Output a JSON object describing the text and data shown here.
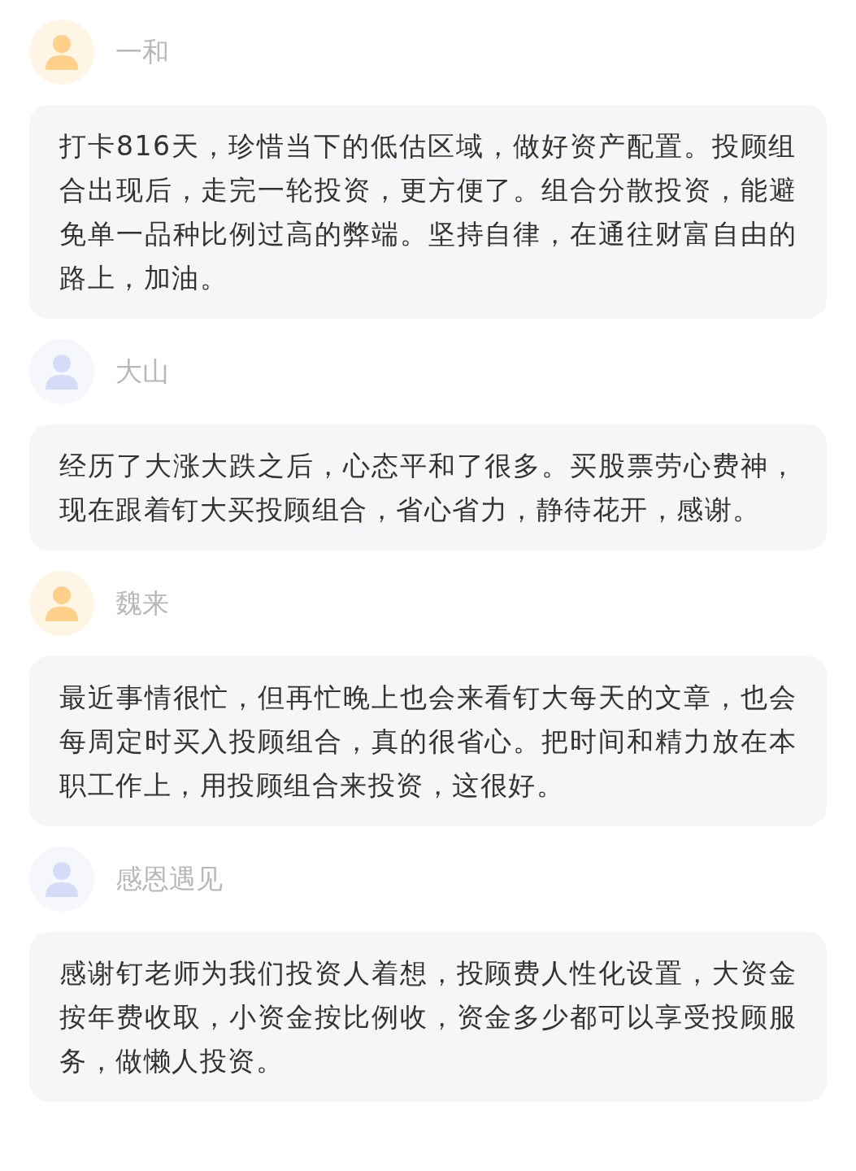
{
  "comments": [
    {
      "name": "一和",
      "color": "#ffd08a",
      "text": "打卡816天，珍惜当下的低估区域，做好资产配置。投顾组合出现后，走完一轮投资，更方便了。组合分散投资，能避免单一品种比例过高的弊端。坚持自律，在通往财富自由的路上，加油。"
    },
    {
      "name": "大山",
      "color": "#d6dcf7",
      "text": "经历了大涨大跌之后，心态平和了很多。买股票劳心费神，现在跟着钉大买投顾组合，省心省力，静待花开，感谢。"
    },
    {
      "name": "魏来",
      "color": "#ffd08a",
      "text": "最近事情很忙，但再忙晚上也会来看钉大每天的文章，也会每周定时买入投顾组合，真的很省心。把时间和精力放在本职工作上，用投顾组合来投资，这很好。"
    },
    {
      "name": "感恩遇见",
      "color": "#d6dcf7",
      "text": "感谢钉老师为我们投资人着想，投顾费人性化设置，大资金按年费收取，小资金按比例收，资金多少都可以享受投顾服务，做懒人投资。"
    }
  ]
}
